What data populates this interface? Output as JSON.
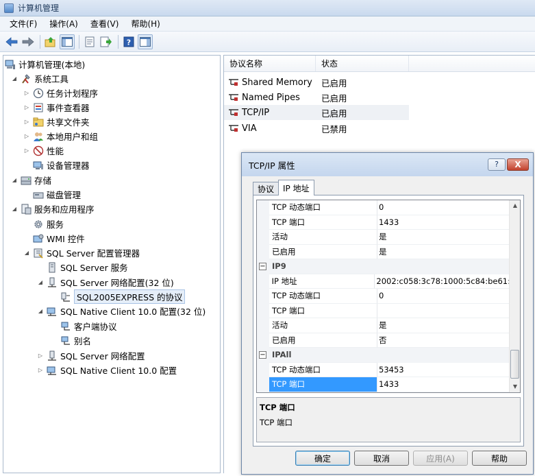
{
  "window": {
    "title": "计算机管理"
  },
  "menu": [
    "文件(F)",
    "操作(A)",
    "查看(V)",
    "帮助(H)"
  ],
  "toolbar": [
    "back-icon",
    "forward-icon",
    "up-folder-icon",
    "show-hide-tree-icon",
    "properties-icon",
    "export-icon",
    "help-icon",
    "show-hide-action-icon"
  ],
  "tree": {
    "root": "计算机管理(本地)",
    "system_tools": "系统工具",
    "task_scheduler": "任务计划程序",
    "event_viewer": "事件查看器",
    "shared_folders": "共享文件夹",
    "local_users": "本地用户和组",
    "performance": "性能",
    "device_manager": "设备管理器",
    "storage": "存储",
    "disk_management": "磁盘管理",
    "services_apps": "服务和应用程序",
    "services": "服务",
    "wmi": "WMI 控件",
    "sql_config": "SQL Server 配置管理器",
    "sql_services": "SQL Server 服务",
    "sql_net32": "SQL Server 网络配置(32 位)",
    "sql_protocols": "SQL2005EXPRESS 的协议",
    "native_client32": "SQL Native Client 10.0 配置(32 位)",
    "client_protocols": "客户端协议",
    "aliases": "别名",
    "sql_net": "SQL Server 网络配置",
    "native_client": "SQL Native Client 10.0 配置"
  },
  "list": {
    "col_name": "协议名称",
    "col_state": "状态",
    "rows": [
      {
        "name": "Shared Memory",
        "state": "已启用"
      },
      {
        "name": "Named Pipes",
        "state": "已启用"
      },
      {
        "name": "TCP/IP",
        "state": "已启用"
      },
      {
        "name": "VIA",
        "state": "已禁用"
      }
    ]
  },
  "dialog": {
    "title": "TCP/IP 属性",
    "help_glyph": "?",
    "close_glyph": "X",
    "tabs": [
      "协议",
      "IP 地址"
    ],
    "rows": [
      {
        "name": "TCP 动态端口",
        "value": "0"
      },
      {
        "name": "TCP 端口",
        "value": "1433"
      },
      {
        "name": "活动",
        "value": "是"
      },
      {
        "name": "已启用",
        "value": "是"
      },
      {
        "section": "IP9",
        "toggle": "−"
      },
      {
        "name": "IP 地址",
        "value": "2002:c058:3c78:1000:5c84:be61:"
      },
      {
        "name": "TCP 动态端口",
        "value": "0"
      },
      {
        "name": "TCP 端口",
        "value": ""
      },
      {
        "name": "活动",
        "value": "是"
      },
      {
        "name": "已启用",
        "value": "否"
      },
      {
        "section": "IPAll",
        "toggle": "−"
      },
      {
        "name": "TCP 动态端口",
        "value": "53453"
      },
      {
        "name": "TCP 端口",
        "value": "1433",
        "selected": true
      }
    ],
    "description_title": "TCP 端口",
    "description_text": "TCP 端口",
    "buttons": {
      "ok": "确定",
      "cancel": "取消",
      "apply": "应用(A)",
      "help": "帮助"
    }
  }
}
